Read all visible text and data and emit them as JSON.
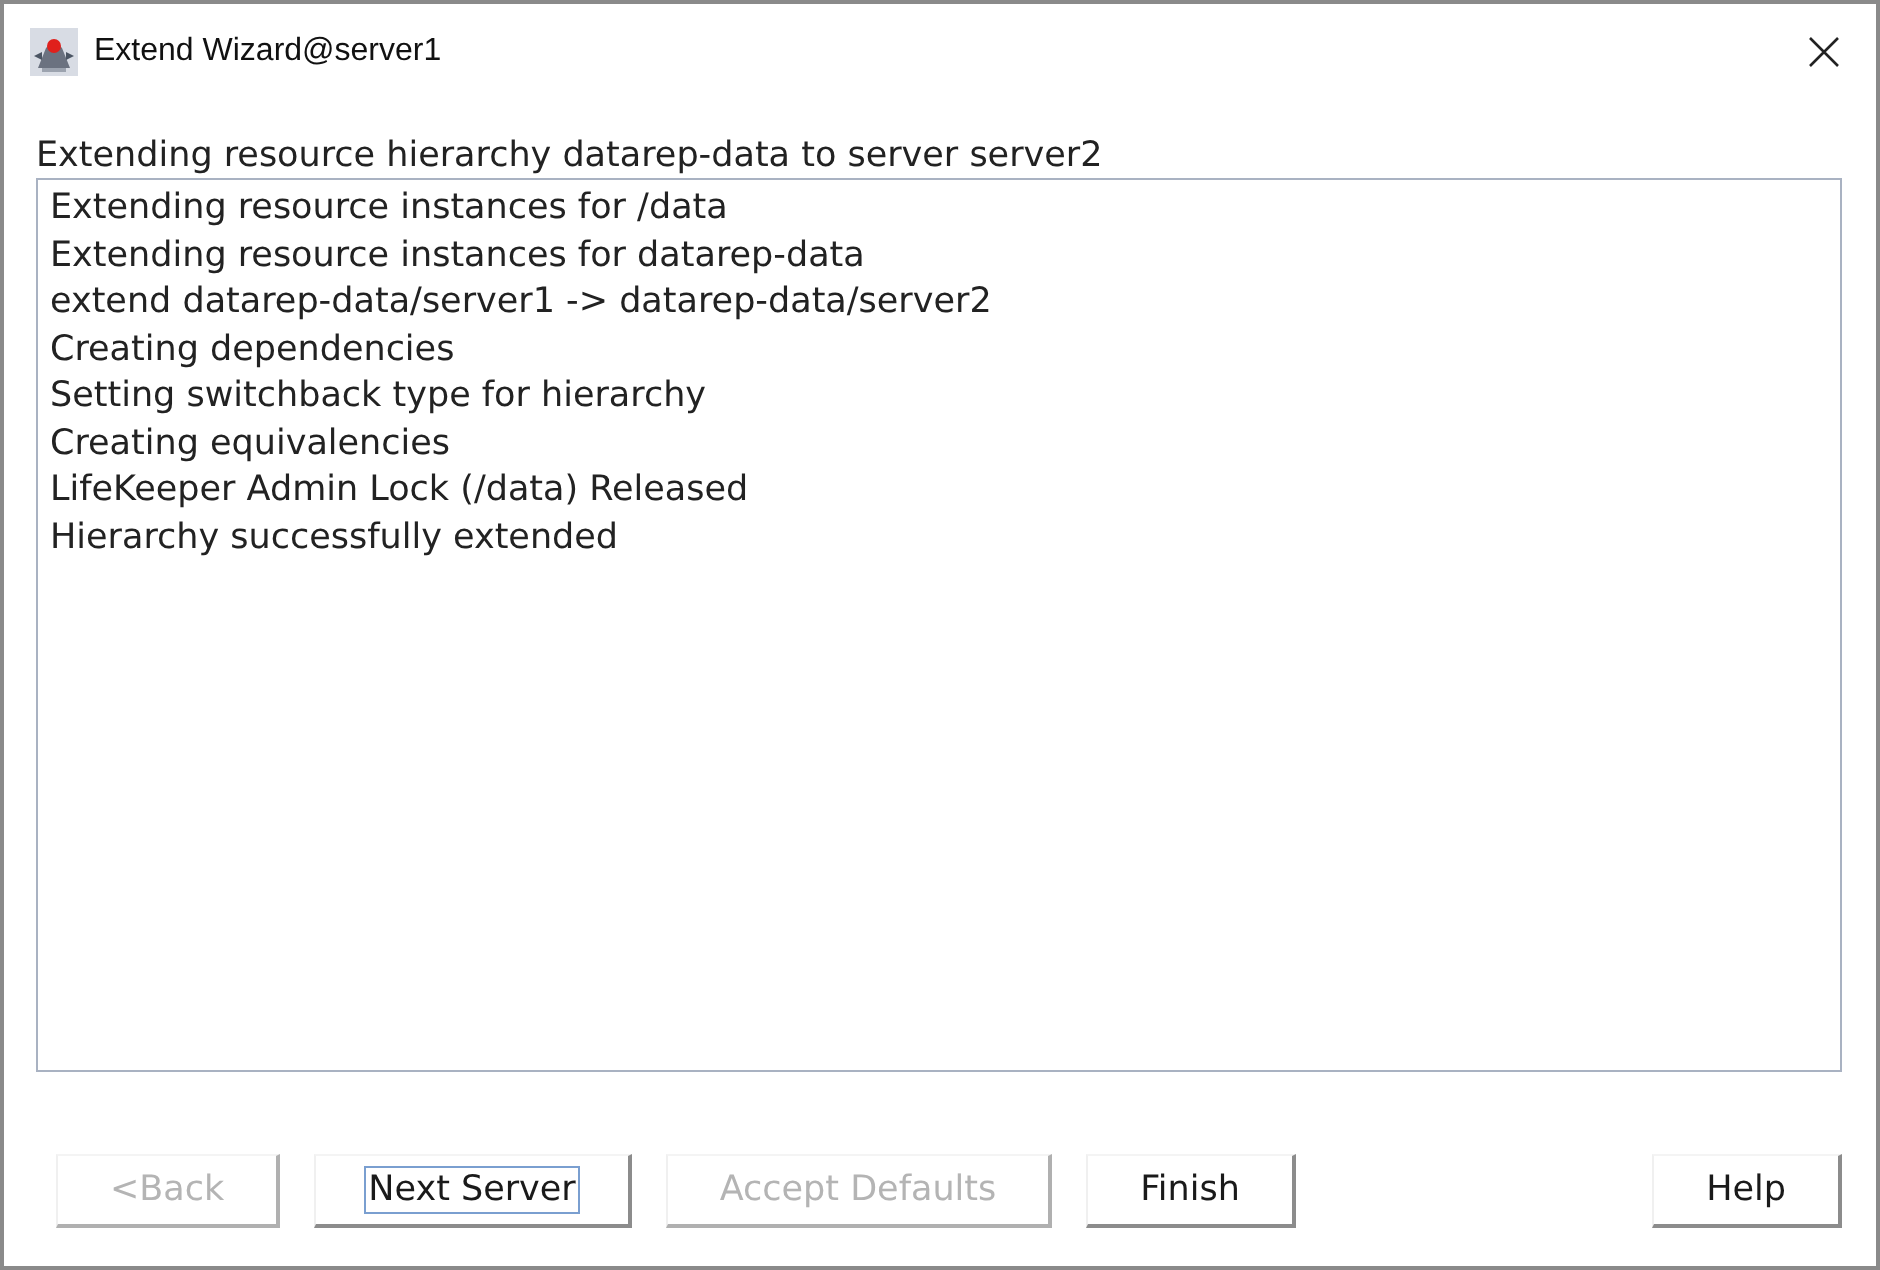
{
  "window": {
    "title": "Extend Wizard@server1"
  },
  "heading": "Extending resource hierarchy datarep-data to server server2",
  "log_lines": [
    "Extending resource instances for /data",
    "Extending resource instances for datarep-data",
    "extend datarep-data/server1 -> datarep-data/server2",
    "Creating dependencies",
    "Setting switchback type for hierarchy",
    "Creating equivalencies",
    "LifeKeeper Admin Lock (/data) Released",
    "Hierarchy successfully extended"
  ],
  "buttons": [
    {
      "label": "<Back",
      "disabled": true,
      "focused": false
    },
    {
      "label": "Next Server",
      "disabled": false,
      "focused": true
    },
    {
      "label": "Accept Defaults",
      "disabled": true,
      "focused": false
    },
    {
      "label": "Finish",
      "disabled": false,
      "focused": false
    },
    {
      "label": "Help",
      "disabled": false,
      "focused": false
    }
  ]
}
